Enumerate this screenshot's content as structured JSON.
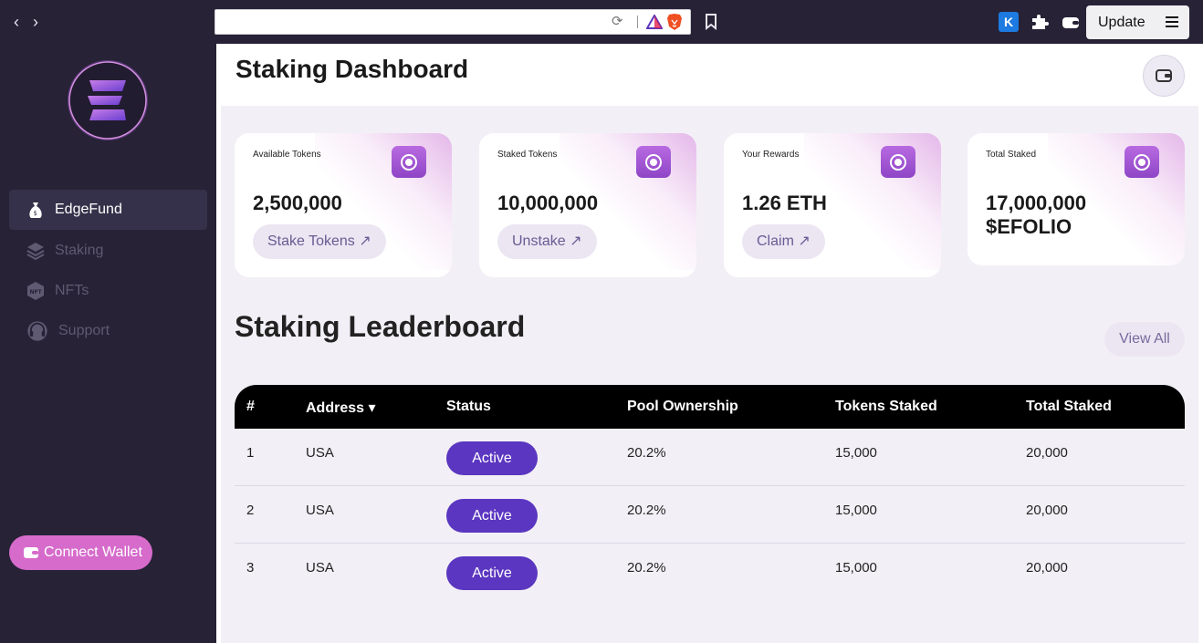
{
  "browser": {
    "back_icon": "chevron-left-icon",
    "forward_icon": "chevron-right-icon",
    "url": "",
    "extension_k_label": "K",
    "update_label": "Update"
  },
  "sidebar": {
    "brand_logo": "edgefund-logo",
    "items": [
      {
        "label": "EdgeFund",
        "icon": "money-bag-icon",
        "active": true
      },
      {
        "label": "Staking",
        "icon": "layers-icon",
        "active": false
      },
      {
        "label": "NFTs",
        "icon": "nft-icon",
        "active": false
      },
      {
        "label": "Support",
        "icon": "headset-icon",
        "active": false
      }
    ],
    "connect_wallet_label": "Connect Wallet"
  },
  "header": {
    "title": "Staking Dashboard",
    "wallet_icon": "wallet-icon"
  },
  "cards": [
    {
      "label": "Available Tokens",
      "value": "2,500,000",
      "button": "Stake Tokens ↗"
    },
    {
      "label": "Staked Tokens",
      "value": "10,000,000",
      "button": "Unstake ↗"
    },
    {
      "label": "Your Rewards",
      "value": "1.26 ETH",
      "button": "Claim ↗"
    },
    {
      "label": "Total Staked",
      "value": "17,000,000 $EFOLIO",
      "button": ""
    }
  ],
  "leaderboard": {
    "title": "Staking Leaderboard",
    "view_all_label": "View All",
    "columns": [
      "#",
      "Address",
      "Status",
      "Pool Ownership",
      "Tokens Staked",
      "Total Staked"
    ],
    "sort_indicator": "▾",
    "rows": [
      {
        "rank": "1",
        "address": "USA",
        "status": "Active",
        "ownership": "20.2%",
        "tokens": "15,000",
        "total": "20,000"
      },
      {
        "rank": "2",
        "address": "USA",
        "status": "Active",
        "ownership": "20.2%",
        "tokens": "15,000",
        "total": "20,000"
      },
      {
        "rank": "3",
        "address": "USA",
        "status": "Active",
        "ownership": "20.2%",
        "tokens": "15,000",
        "total": "20,000"
      }
    ]
  },
  "colors": {
    "sidebar_bg": "#272236",
    "accent_purple": "#5b36c0",
    "connect_pink": "#d66bcb"
  }
}
